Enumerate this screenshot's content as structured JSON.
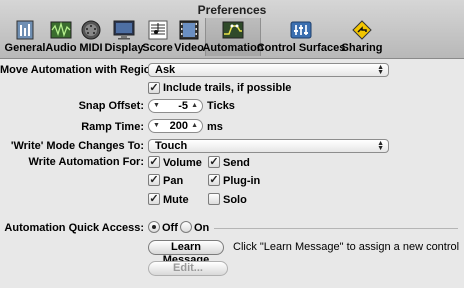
{
  "window": {
    "title": "Preferences"
  },
  "toolbar": [
    {
      "label": "General",
      "icon": "general-icon"
    },
    {
      "label": "Audio",
      "icon": "audio-icon"
    },
    {
      "label": "MIDI",
      "icon": "midi-icon"
    },
    {
      "label": "Display",
      "icon": "display-icon"
    },
    {
      "label": "Score",
      "icon": "score-icon"
    },
    {
      "label": "Video",
      "icon": "video-icon"
    },
    {
      "label": "Automation",
      "icon": "automation-icon"
    },
    {
      "label": "Control Surfaces",
      "icon": "control-surfaces-icon"
    },
    {
      "label": "Sharing",
      "icon": "sharing-icon"
    }
  ],
  "settings": {
    "move_automation_label": "Move Automation with Regions:",
    "move_automation_value": "Ask",
    "include_trails_label": "Include trails, if possible",
    "snap_offset_label": "Snap Offset:",
    "snap_offset_value": "-5",
    "snap_offset_unit": "Ticks",
    "ramp_time_label": "Ramp Time:",
    "ramp_time_value": "200",
    "ramp_time_unit": "ms",
    "write_mode_label": "'Write' Mode Changes To:",
    "write_mode_value": "Touch",
    "write_automation_label": "Write Automation For:",
    "write_for": [
      {
        "label": "Volume",
        "checked": true
      },
      {
        "label": "Send",
        "checked": true
      },
      {
        "label": "Pan",
        "checked": true
      },
      {
        "label": "Plug-in",
        "checked": true
      },
      {
        "label": "Mute",
        "checked": true
      },
      {
        "label": "Solo",
        "checked": false
      }
    ],
    "quick_access_label": "Automation Quick Access:",
    "off_label": "Off",
    "on_label": "On",
    "learn_button": "Learn Message",
    "learn_hint": "Click \"Learn Message\" to assign a new control",
    "edit_button": "Edit..."
  },
  "colors": {
    "background": "#e8e8e8",
    "active_tab": "#a6a6a6"
  }
}
